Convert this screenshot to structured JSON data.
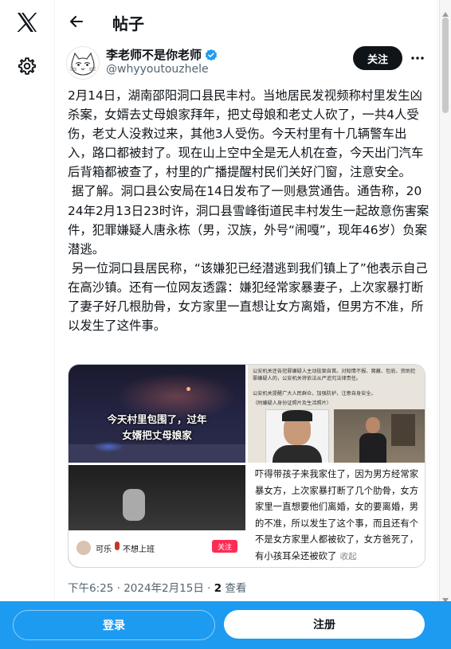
{
  "header": {
    "title": "帖子"
  },
  "author": {
    "display_name": "李老师不是你老师",
    "handle": "@whyyoutouzhele",
    "follow_label": "关注"
  },
  "tweet": {
    "text": "2月14日，湖南邵阳洞口县民丰村。当地居民发视频称村里发生凶杀案，女婿去丈母娘家拜年，把丈母娘和老丈人砍了，一共4人受伤，老丈人没救过来，其他3人受伤。今天村里有十几辆警车出入，路口都被封了。现在山上空中全是无人机在查，今天出门汽车后背箱都被查了，村里的广播提醒村民们关好门窗，注意安全。\n 据了解。洞口县公安局在14日发布了一则悬赏通告。通告称，2024年2月13日23时许，洞口县雪峰街道民丰村发生一起故意伤害案件，犯罪嫌疑人唐永栋（男，汉族，外号“闹嘎”，现年46岁）负案潜逃。\n 另一位洞口县居民称，“该嫌犯已经潜逃到我们镇上了”他表示自己在高沙镇。还有一位网友透露：嫌犯经常家暴妻子，上次家暴打断了妻子好几根肋骨，女方家里一直想让女方离婚，但男方不准，所以发生了这件事。",
    "time": "下午6:25",
    "date": "2024年2月15日",
    "views_count": "2",
    "views_label": "查看"
  },
  "media": {
    "video_caption_line1": "今天村里包围了，过年",
    "video_caption_line2": "女婿把丈母娘家",
    "notice_line1": "公安机关还告犯罪嫌疑人主动投案自首。对知情不报、窝藏、包庇、资助犯罪嫌疑人的，公安机关将依法从严追究法律责任。",
    "notice_line2": "公安机关提醒广大人民群众，加强防护，注意自身安全。",
    "notice_line3": "（附嫌疑人身份证照片及生活照片）",
    "chat_text": "吓得带孩子来我家住了，因为男方经常家暴女方，上次家暴打断了几个肋骨，女方家里一直想要他们离婚，女的要离婚，男的不准，所以发生了这个事，而且还有个不是女方家里人都被砍了，女方爸死了，有小孩耳朵还被砍了",
    "collapse_label": "收起",
    "video_user_name": "可乐",
    "video_user_text": "不想上班",
    "video_follow_label": "关注"
  },
  "bottom_bar": {
    "login_label": "登录",
    "signup_label": "注册"
  },
  "colors": {
    "accent": "#1d9bf0",
    "text": "#0f1419",
    "muted": "#536471",
    "verified": "#1d9bf0"
  },
  "icons": {
    "logo": "x-logo-icon",
    "settings": "gear-icon",
    "back": "back-arrow-icon",
    "verified": "verified-badge-icon",
    "more": "more-horizontal-icon"
  }
}
